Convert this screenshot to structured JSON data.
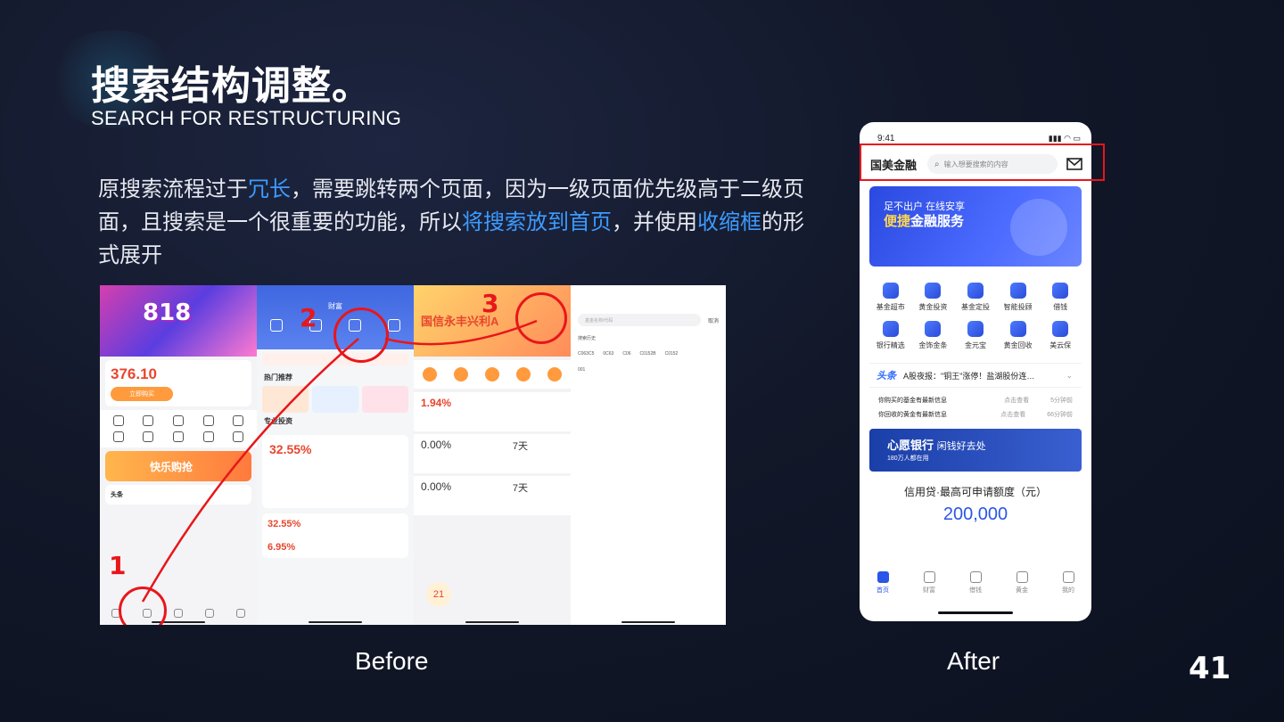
{
  "slide": {
    "title": "搜索结构调整。",
    "subtitle": "SEARCH FOR RESTRUCTURING",
    "description": {
      "p1": "原搜索流程过于",
      "h1": "冗长",
      "p2": "，需要跳转两个页面，因为一级页面优先级高于二级页面，且搜索是一个很重要的功能，所以",
      "h2": "将搜索放到首页",
      "p3": "，并使用",
      "h3": "收缩框",
      "p4": "的形式展开"
    },
    "before_label": "Before",
    "after_label": "After",
    "page_number": "41",
    "accent_color": "#3d9bff",
    "highlight_color": "#e8161a"
  },
  "before": {
    "step_numbers": [
      "1",
      "2",
      "3"
    ],
    "p1": {
      "banner": "818",
      "value": "376.10",
      "button": "立即购买",
      "promo": "快乐购抢",
      "news": "头条"
    },
    "p2": {
      "title": "财富",
      "section1": "热门推荐",
      "section2": "专业投资",
      "pct1": "32.55%",
      "pct2": "32.55%",
      "pct3": "6.95%"
    },
    "p3": {
      "headline": "国信永丰兴利A",
      "pct": "1.94%",
      "rate1": "0.00%",
      "days1": "7天",
      "rate2": "0.00%",
      "days2": "7天",
      "badge": "21"
    },
    "p4": {
      "search_placeholder": "基金名称/代码",
      "cancel": "取消",
      "history_title": "搜索历史",
      "history": [
        "C063C5",
        "0C63",
        "C06",
        "C0152B",
        "C0152",
        "001"
      ]
    }
  },
  "after": {
    "status_time": "9:41",
    "brand": "国美金融",
    "search_placeholder": "输入想要搜索的内容",
    "banner_line1": "足不出户 在线安享",
    "banner_line2_highlight": "便捷",
    "banner_line2_rest": "金融服务",
    "grid": [
      "基金超市",
      "黄金投资",
      "基金定投",
      "智能投顾",
      "借钱",
      "银行精选",
      "金饰金条",
      "金元宝",
      "黄金回收",
      "美云保"
    ],
    "news_logo": "头条",
    "news_text": "A股夜报：\"铜王\"涨停！盐湖股份连…",
    "notes": [
      {
        "text": "你购买的基金有最新信息",
        "action": "点击查看",
        "time": "5分钟前"
      },
      {
        "text": "你回收的黄金有最新信息",
        "action": "点击查看",
        "time": "66分钟前"
      }
    ],
    "wish_title": "心愿银行",
    "wish_slogan": "闲钱好去处",
    "wish_sub": "180万人都在用",
    "credit_title": "信用贷·最高可申请额度（元）",
    "credit_value": "200,000",
    "tabs": [
      "首页",
      "财富",
      "借钱",
      "黄金",
      "我的"
    ]
  }
}
